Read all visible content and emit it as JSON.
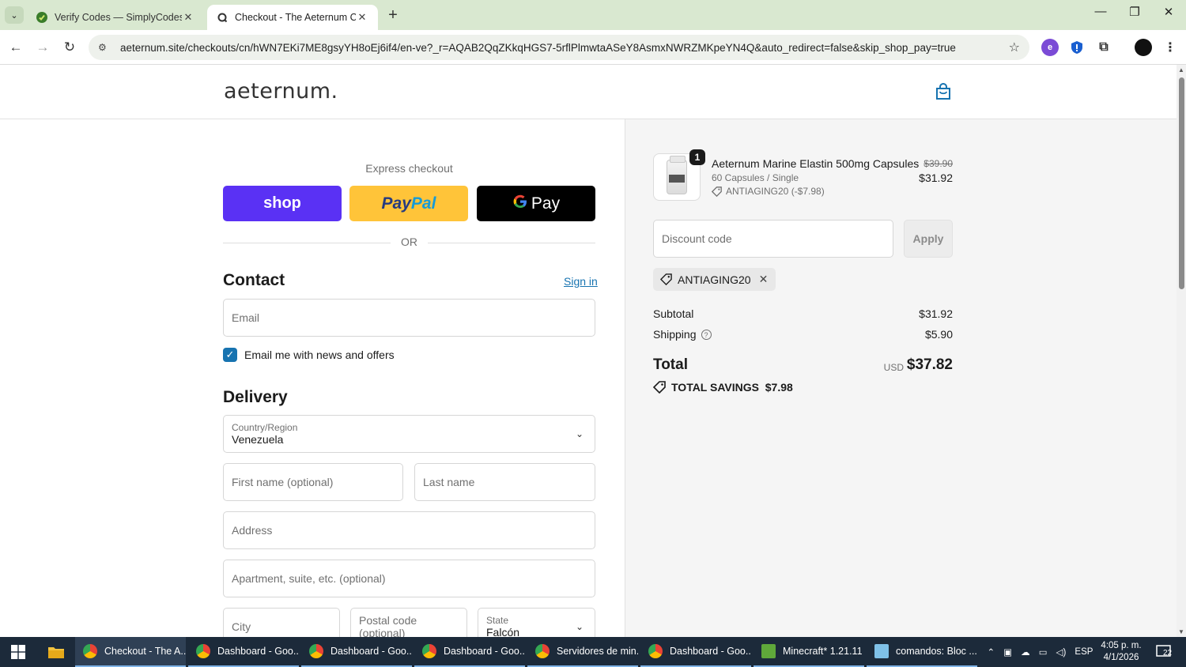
{
  "browser": {
    "tabs": [
      {
        "title": "Verify Codes — SimplyCodes",
        "favicon": "simplycodes-icon",
        "active": false
      },
      {
        "title": "Checkout - The Aeternum Com",
        "favicon": "loading-icon",
        "active": true
      }
    ],
    "url": "aeternum.site/checkouts/cn/hWN7EKi7ME8gsyYH8oEj6if4/en-ve?_r=AQAB2QqZKkqHGS7-5rflPlmwtaASeY8AsmxNWRZMKpeYN4Q&auto_redirect=false&skip_shop_pay=true"
  },
  "store": {
    "logo_text": "aeternum."
  },
  "express": {
    "label": "Express checkout",
    "shop_label": "shop",
    "paypal_label_1": "Pay",
    "paypal_label_2": "Pal",
    "gpay_g": "G",
    "gpay_label": "Pay",
    "or_text": "OR"
  },
  "contact": {
    "heading": "Contact",
    "sign_in": "Sign in",
    "email_placeholder": "Email",
    "newsletter_label": "Email me with news and offers",
    "newsletter_checked": true
  },
  "delivery": {
    "heading": "Delivery",
    "country_label": "Country/Region",
    "country_value": "Venezuela",
    "first_name_placeholder": "First name (optional)",
    "last_name_placeholder": "Last name",
    "address_placeholder": "Address",
    "apartment_placeholder": "Apartment, suite, etc. (optional)",
    "city_placeholder": "City",
    "postal_placeholder": "Postal code (optional)",
    "state_label": "State",
    "state_value": "Falcón"
  },
  "order": {
    "item": {
      "quantity": "1",
      "name": "Aeternum Marine Elastin 500mg Capsules",
      "variant": "60 Capsules / Single",
      "discount": "ANTIAGING20 (-$7.98)",
      "compare_price": "$39.90",
      "price": "$31.92"
    },
    "discount_placeholder": "Discount code",
    "apply_label": "Apply",
    "applied_code": "ANTIAGING20",
    "subtotal_label": "Subtotal",
    "subtotal_value": "$31.92",
    "shipping_label": "Shipping",
    "shipping_value": "$5.90",
    "total_label": "Total",
    "currency": "USD",
    "total_value": "$37.82",
    "savings_label": "TOTAL SAVINGS",
    "savings_value": "$7.98"
  },
  "taskbar": {
    "items": [
      {
        "label": "Checkout - The A...",
        "icon": "chrome-icon"
      },
      {
        "label": "Dashboard - Goo...",
        "icon": "chrome-icon"
      },
      {
        "label": "Dashboard - Goo...",
        "icon": "chrome-icon"
      },
      {
        "label": "Dashboard - Goo...",
        "icon": "chrome-icon"
      },
      {
        "label": "Servidores de min...",
        "icon": "chrome-icon"
      },
      {
        "label": "Dashboard - Goo...",
        "icon": "chrome-icon"
      },
      {
        "label": "Minecraft* 1.21.11",
        "icon": "minecraft-icon"
      },
      {
        "label": "comandos: Bloc ...",
        "icon": "notepad-icon"
      }
    ],
    "language": "ESP",
    "time": "4:05 p. m.",
    "date": "4/1/2026",
    "notifications": "22"
  },
  "colors": {
    "accent": "#1773b0",
    "shop_pay": "#5a31f4",
    "paypal": "#ffc439",
    "tabbar": "#d9e8d0",
    "taskbar": "#1c2a3a"
  }
}
